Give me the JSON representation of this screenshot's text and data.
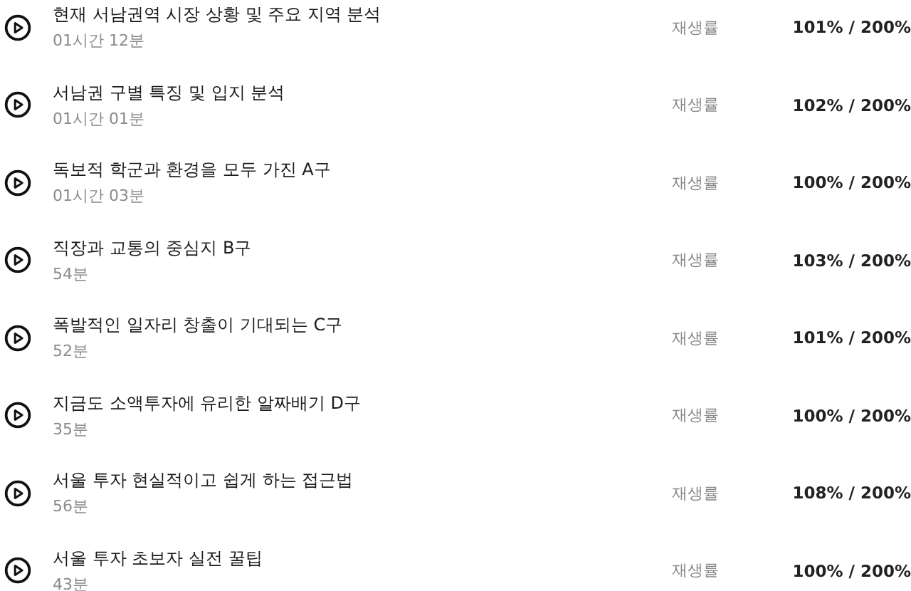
{
  "lectures": [
    {
      "title": "현재 서남권역 시장 상황 및 주요 지역 분석",
      "duration": "01시간 12분",
      "rate_label": "재생률",
      "rate": "101% / 200%"
    },
    {
      "title": "서남권 구별 특징 및 입지 분석",
      "duration": "01시간 01분",
      "rate_label": "재생률",
      "rate": "102% / 200%"
    },
    {
      "title": "독보적 학군과 환경을 모두 가진 A구",
      "duration": "01시간 03분",
      "rate_label": "재생률",
      "rate": "100% / 200%"
    },
    {
      "title": "직장과 교통의 중심지 B구",
      "duration": "54분",
      "rate_label": "재생률",
      "rate": "103% / 200%"
    },
    {
      "title": "폭발적인 일자리 창출이 기대되는 C구",
      "duration": "52분",
      "rate_label": "재생률",
      "rate": "101% / 200%"
    },
    {
      "title": "지금도 소액투자에 유리한 알짜배기 D구",
      "duration": "35분",
      "rate_label": "재생률",
      "rate": "100% / 200%"
    },
    {
      "title": "서울 투자 현실적이고 쉽게 하는 접근법",
      "duration": "56분",
      "rate_label": "재생률",
      "rate": "108% / 200%"
    },
    {
      "title": "서울 투자 초보자 실전 꿀팁",
      "duration": "43분",
      "rate_label": "재생률",
      "rate": "100% / 200%"
    }
  ]
}
